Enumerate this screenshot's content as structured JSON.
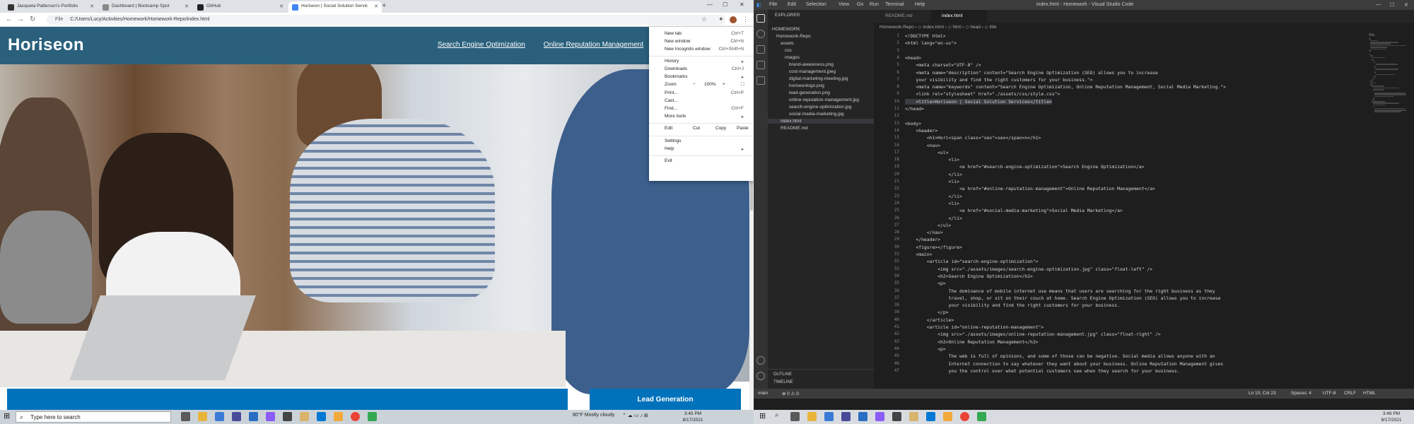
{
  "browser": {
    "tabs": [
      {
        "label": "Jacqueta Patterson's Portfolio",
        "favicon_color": "#333333",
        "active": false
      },
      {
        "label": "Dashboard | Bootcamp Spot",
        "favicon_color": "#888888",
        "active": false
      },
      {
        "label": "GitHub",
        "favicon_color": "#222222",
        "active": false
      },
      {
        "label": "Horiseon | Social Solution Servic",
        "favicon_color": "#4285f4",
        "active": true
      }
    ],
    "address_label": "File",
    "address_url": "C:/Users/Lucy/Activities/Homework/Homework-Repo/index.html"
  },
  "site": {
    "logo": "Horiseon",
    "nav": [
      "Search Engine Optimization",
      "Online Reputation Management"
    ],
    "sidebar_title": "Lead Generation",
    "header_color": "#2a607c",
    "accent_color": "#0072bb"
  },
  "chrome_menu": {
    "items": [
      {
        "label": "New tab",
        "shortcut": "Ctrl+T"
      },
      {
        "label": "New window",
        "shortcut": "Ctrl+N"
      },
      {
        "label": "New Incognito window",
        "shortcut": "Ctrl+Shift+N"
      },
      {
        "label": "History",
        "shortcut": "▸"
      },
      {
        "label": "Downloads",
        "shortcut": "Ctrl+J"
      },
      {
        "label": "Bookmarks",
        "shortcut": "▸"
      },
      {
        "label": "Print...",
        "shortcut": "Ctrl+P"
      },
      {
        "label": "Cast...",
        "shortcut": ""
      },
      {
        "label": "Find...",
        "shortcut": "Ctrl+F"
      },
      {
        "label": "More tools",
        "shortcut": "▸"
      },
      {
        "label": "Settings",
        "shortcut": ""
      },
      {
        "label": "Help",
        "shortcut": "▸"
      },
      {
        "label": "Exit",
        "shortcut": ""
      }
    ],
    "zoom_label": "Zoom",
    "zoom_minus": "−",
    "zoom_value": "100%",
    "zoom_plus": "+",
    "edit_label": "Edit",
    "cut": "Cut",
    "copy": "Copy",
    "paste": "Paste"
  },
  "taskbar": {
    "search_placeholder": "Type here to search",
    "weather": "80°F  Mostly cloudy",
    "time": "3:45 PM",
    "date": "8/17/2021"
  },
  "vscode": {
    "menus": [
      "File",
      "Edit",
      "Selection",
      "View",
      "Go",
      "Run",
      "Terminal",
      "Help"
    ],
    "title": "index.html - Homework - Visual Studio Code",
    "explorer_title": "EXPLORER",
    "explorer": [
      {
        "label": "HOMEWORK",
        "indent": 0,
        "selected": false
      },
      {
        "label": "Homework-Repo",
        "indent": 1,
        "selected": false
      },
      {
        "label": "assets",
        "indent": 2,
        "selected": false
      },
      {
        "label": "css",
        "indent": 3,
        "selected": false
      },
      {
        "label": "images",
        "indent": 3,
        "selected": false
      },
      {
        "label": "brand-awareness.png",
        "indent": 4,
        "selected": false
      },
      {
        "label": "cost-management.jpeg",
        "indent": 4,
        "selected": false
      },
      {
        "label": "digital-marketing-meeting.jpg",
        "indent": 4,
        "selected": false
      },
      {
        "label": "horiseonlogo.png",
        "indent": 4,
        "selected": false
      },
      {
        "label": "lead-generation.png",
        "indent": 4,
        "selected": false
      },
      {
        "label": "online-reputation-management.jpg",
        "indent": 4,
        "selected": false
      },
      {
        "label": "search-engine-optimization.jpg",
        "indent": 4,
        "selected": false
      },
      {
        "label": "social-media-marketing.jpg",
        "indent": 4,
        "selected": false
      },
      {
        "label": "index.html",
        "indent": 2,
        "selected": true
      },
      {
        "label": "README.md",
        "indent": 2,
        "selected": false
      }
    ],
    "outline": [
      "OUTLINE",
      "TIMELINE"
    ],
    "tabs": [
      "README.md",
      "index.html"
    ],
    "breadcrumb": "Homework-Repo › ◇ index.html › ◇ html › ◇ head › ◇ title",
    "code": [
      "<!DOCTYPE html>",
      "<html lang=\"en-us\">",
      "",
      "<head>",
      "    <meta charset=\"UTF-8\" />",
      "    <meta name=\"description\" content=\"Search Engine Optimization (SEO) allows you to increase",
      "    your visibility and find the right customers for your business.\">",
      "    <meta name=\"keywords\" content=\"Search Engine Optimization, Online Reputation Management, Social Media Marketing.\">",
      "    <link rel=\"stylesheet\" href=\"./assets/css/style.css\">",
      "    <title>Horiseon | Social Solution Services</title>",
      "</head>",
      "",
      "<body>",
      "    <header>",
      "        <h1>Hori<span class=\"seo\">seo</span>n</h1>",
      "        <nav>",
      "            <ul>",
      "                <li>",
      "                    <a href=\"#search-engine-optimization\">Search Engine Optimization</a>",
      "                </li>",
      "                <li>",
      "                    <a href=\"#online-reputation-management\">Online Reputation Management</a>",
      "                </li>",
      "                <li>",
      "                    <a href=\"#social-media-marketing\">Social Media Marketing</a>",
      "                </li>",
      "            </ul>",
      "        </nav>",
      "    </header>",
      "    <figure></figure>",
      "    <main>",
      "        <article id=\"search-engine-optimization\">",
      "            <img src=\"./assets/images/search-engine-optimization.jpg\" class=\"float-left\" />",
      "            <h2>Search Engine Optimization</h2>",
      "            <p>",
      "                The dominance of mobile internet use means that users are searching for the right business as they",
      "                travel, shop, or sit on their couch at home. Search Engine Optimization (SEO) allows you to increase",
      "                your visibility and find the right customers for your business.",
      "            </p>",
      "        </article>",
      "        <article id=\"online-reputation-management\">",
      "            <img src=\"./assets/images/online-reputation-management.jpg\" class=\"float-right\" />",
      "            <h2>Online Reputation Management</h2>",
      "            <p>",
      "                The web is full of opinions, and some of those can be negative. Social media allows anyone with an",
      "                Internet connection to say whatever they want about your business. Online Reputation Management gives",
      "                you the control over what potential customers see when they search for your business."
    ],
    "highlight_line": 10,
    "status": {
      "branch": "main",
      "errors": "⊗ 0  ⚠ 0",
      "position": "Ln 10, Col 23",
      "spaces": "Spaces: 4",
      "encoding": "UTF-8",
      "eol": "CRLF",
      "language": "HTML"
    },
    "clock_time": "3:46 PM",
    "clock_date": "8/17/2021"
  }
}
